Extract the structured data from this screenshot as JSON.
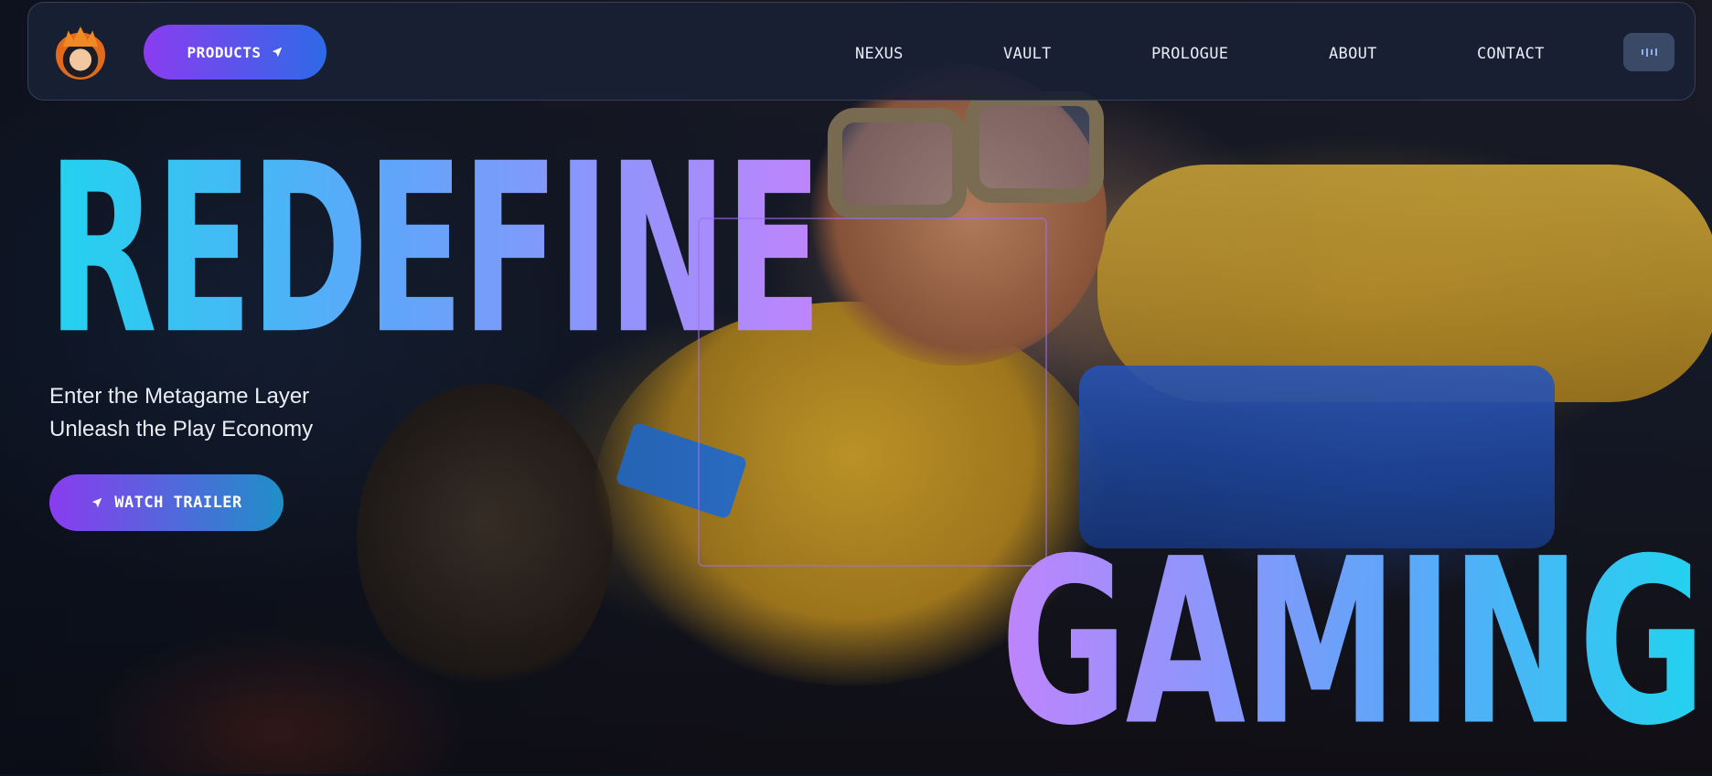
{
  "nav": {
    "logo_icon": "ninja-avatar-logo",
    "products_label": "PRODUCTS",
    "products_icon": "send-arrow-icon",
    "links": [
      {
        "label": "NEXUS"
      },
      {
        "label": "VAULT"
      },
      {
        "label": "PROLOGUE"
      },
      {
        "label": "ABOUT"
      },
      {
        "label": "CONTACT"
      }
    ],
    "audio_icon": "audio-bars-icon"
  },
  "hero": {
    "headline_top": "REDEFINE",
    "headline_bottom": "GAMING",
    "tagline_line1": "Enter the Metagame Layer",
    "tagline_line2": "Unleash the Play Economy",
    "cta_label": "WATCH TRAILER",
    "cta_icon": "send-arrow-icon"
  },
  "colors": {
    "accent_purple": "#8a3cf0",
    "accent_blue": "#2e6ae6",
    "headline_cyan": "#22d3ee",
    "headline_violet": "#c084fc"
  }
}
